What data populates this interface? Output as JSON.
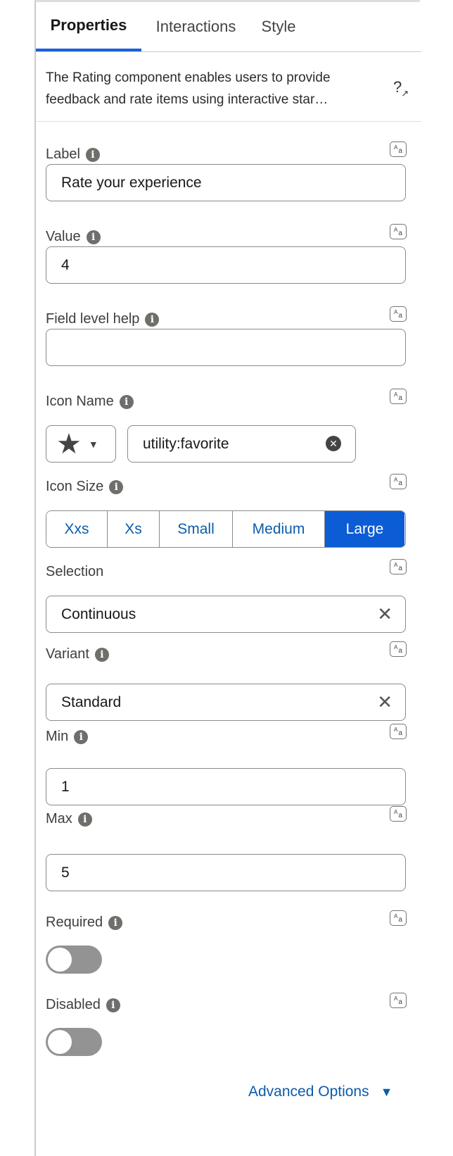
{
  "tabs": [
    {
      "label": "Properties",
      "active": true
    },
    {
      "label": "Interactions",
      "active": false
    },
    {
      "label": "Style",
      "active": false
    }
  ],
  "description": "The Rating component enables users to provide feedback and rate items using interactive star…",
  "help_icon": "help-external-link-icon",
  "fields": {
    "label": {
      "label": "Label",
      "value": "Rate your experience"
    },
    "value": {
      "label": "Value",
      "value": "4"
    },
    "field_level_help": {
      "label": "Field level help",
      "value": ""
    },
    "icon_name": {
      "label": "Icon Name",
      "value": "utility:favorite",
      "icon": "★"
    },
    "icon_size": {
      "label": "Icon Size",
      "options": [
        "Xxs",
        "Xs",
        "Small",
        "Medium",
        "Large"
      ],
      "selected": "Large"
    },
    "selection": {
      "label": "Selection",
      "value": "Continuous"
    },
    "variant": {
      "label": "Variant",
      "value": "Standard"
    },
    "min": {
      "label": "Min",
      "value": "1"
    },
    "max": {
      "label": "Max",
      "value": "5"
    },
    "required": {
      "label": "Required",
      "checked": false
    },
    "disabled": {
      "label": "Disabled",
      "checked": false
    }
  },
  "info_glyph": "i",
  "clear_glyph": "✕",
  "advanced_options": "Advanced Options",
  "colors": {
    "accent": "#0b5cd5",
    "link": "#0b5cab",
    "toggle_off": "#939393"
  }
}
